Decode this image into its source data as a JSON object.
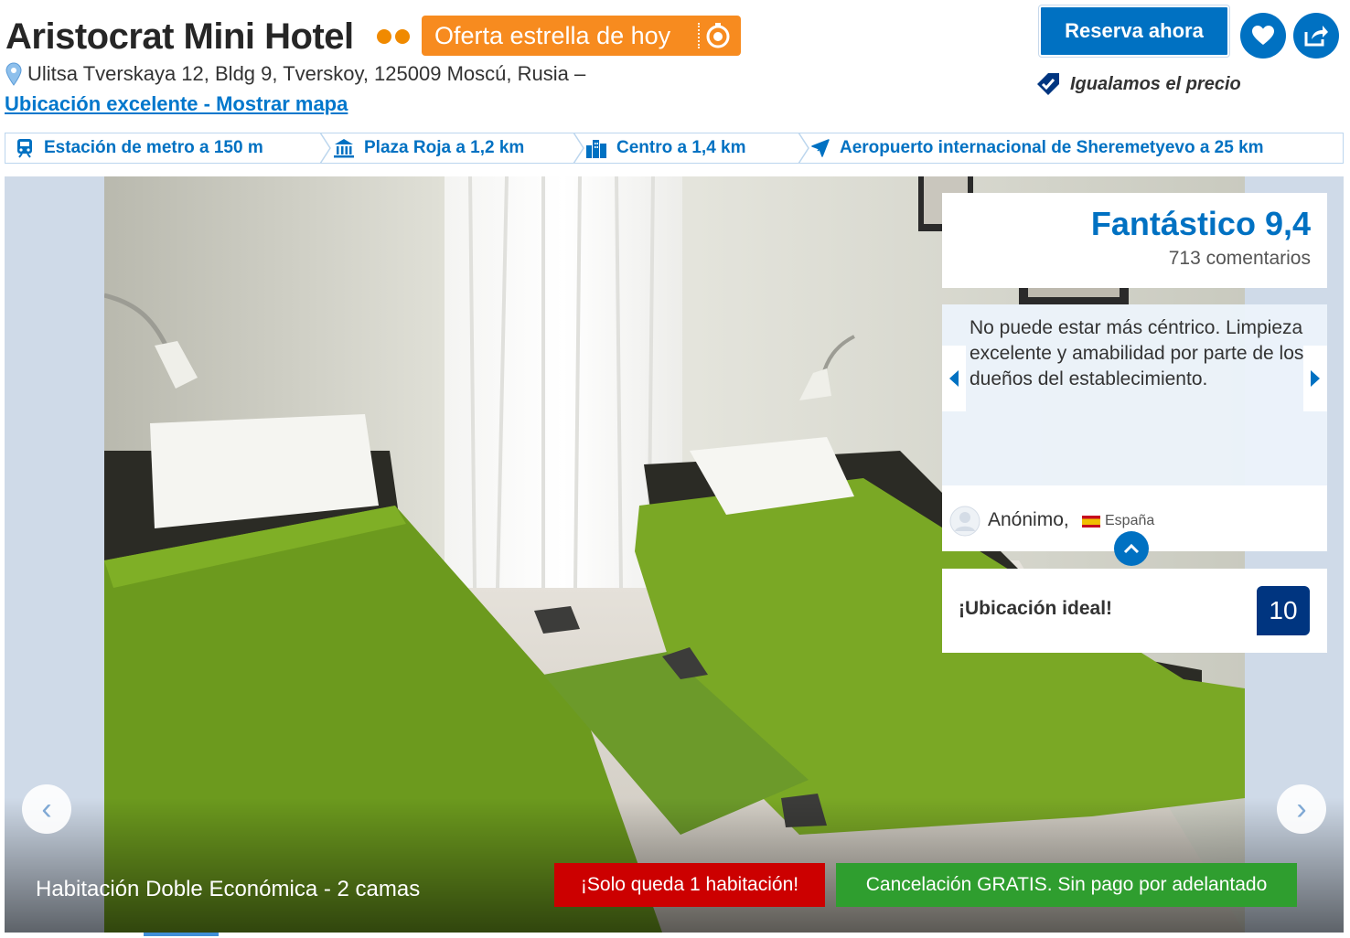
{
  "header": {
    "hotel_name": "Aristocrat Mini Hotel",
    "star_count": 2,
    "deal_badge": "Oferta estrella de hoy",
    "address": "Ulitsa Tverskaya 12, Bldg 9, Tverskoy, 125009 Moscú, Rusia –",
    "map_link": "Ubicación excelente - Mostrar mapa",
    "book_button": "Reserva ahora",
    "price_match": "Igualamos el precio",
    "icons": {
      "favorite": "heart-icon",
      "share": "share-icon",
      "location": "map-pin-icon",
      "price_match": "tag-check-icon"
    }
  },
  "landmarks": [
    {
      "label": "Estación de metro a 150 m",
      "icon": "train-icon"
    },
    {
      "label": "Plaza Roja a 1,2 km",
      "icon": "museum-icon"
    },
    {
      "label": "Centro a 1,4 km",
      "icon": "city-icon"
    },
    {
      "label": "Aeropuerto internacional de Sheremetyevo a 25 km",
      "icon": "plane-icon"
    }
  ],
  "gallery": {
    "room_name": "Habitación Doble Económica - 2 camas",
    "availability_badge": "¡Solo queda 1 habitación!",
    "cancellation_badge": "Cancelación GRATIS. Sin pago por adelantado",
    "prev_arrow": "‹",
    "next_arrow": "›"
  },
  "review_panel": {
    "score_label": "Fantástico 9,4",
    "review_count": "713 comentarios",
    "review_text": "No puede estar más céntrico. Limpieza excelente y amabilidad por parte de los dueños del establecimiento.",
    "reviewer_name": "Anónimo,",
    "reviewer_country": "España",
    "highlight_text": "¡Ubicación ideal!",
    "highlight_score": "10"
  },
  "colors": {
    "brand_blue": "#0071c2",
    "deal_orange": "#f78b1f",
    "star_orange": "#f08a00",
    "alert_red": "#cc0000",
    "success_green": "#2f9e2f",
    "score_navy": "#003580"
  }
}
